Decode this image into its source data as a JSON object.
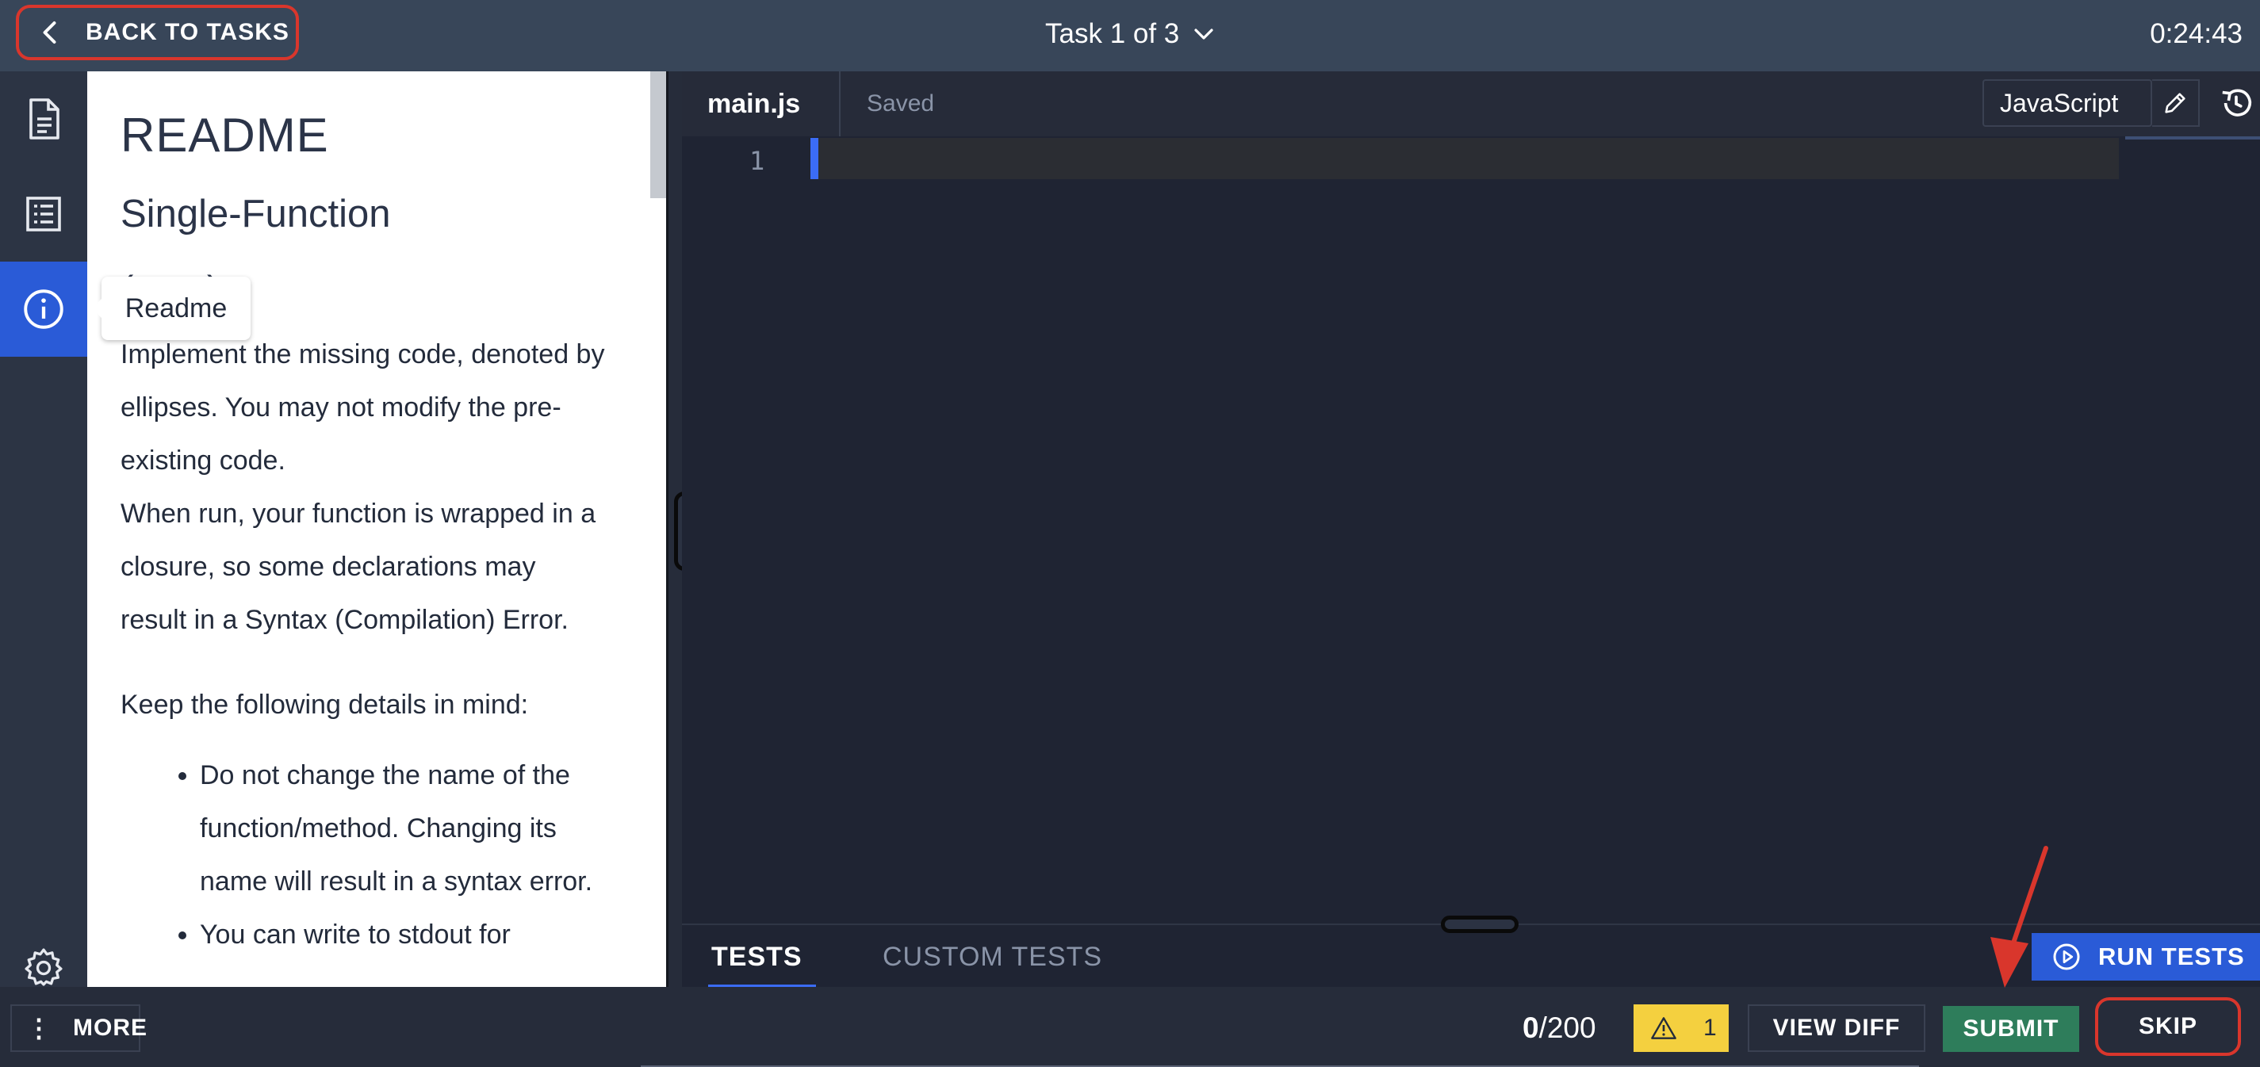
{
  "topbar": {
    "back_label": "BACK TO TASKS",
    "task_title": "Task 1 of 3",
    "timer": "0:24:43"
  },
  "rail": {
    "items": [
      "document-icon",
      "list-icon",
      "info-icon"
    ],
    "active": "info-icon",
    "settings": "gear-icon"
  },
  "tooltip": {
    "text": "Readme"
  },
  "readme": {
    "heading": "README",
    "title_line1": "Single-Function",
    "title_line2": "(very)",
    "p1_lines": [
      "Implement the missing code, denoted by",
      "ellipses. You may not modify the pre-",
      "existing code."
    ],
    "p2_lines": [
      "When run, your function is wrapped in a",
      "closure, so some declarations may",
      "result in a Syntax (Compilation) Error."
    ],
    "p3": "Keep the following details in mind:",
    "bullet1_lines": [
      "Do not change the name of the",
      "function/method. Changing its",
      "name will result in a syntax error."
    ],
    "bullet2_line": "You can write to stdout for"
  },
  "editor": {
    "file_name": "main.js",
    "save_status": "Saved",
    "language": "JavaScript",
    "line_number": "1"
  },
  "tests_bar": {
    "tab_tests": "TESTS",
    "tab_custom": "CUSTOM TESTS",
    "run_label": "RUN TESTS"
  },
  "bottombar": {
    "more_label": "MORE",
    "score_value": "0",
    "score_total": "/200",
    "warning_count": "1",
    "view_diff_label": "VIEW DIFF",
    "submit_label": "SUBMIT",
    "skip_label": "SKIP"
  },
  "colors": {
    "topbar": "#384659",
    "accent_blue": "#2a5bd7",
    "submit_green": "#2e7d5b",
    "warning_yellow": "#f4d03f",
    "highlight_red": "#d9362c"
  }
}
